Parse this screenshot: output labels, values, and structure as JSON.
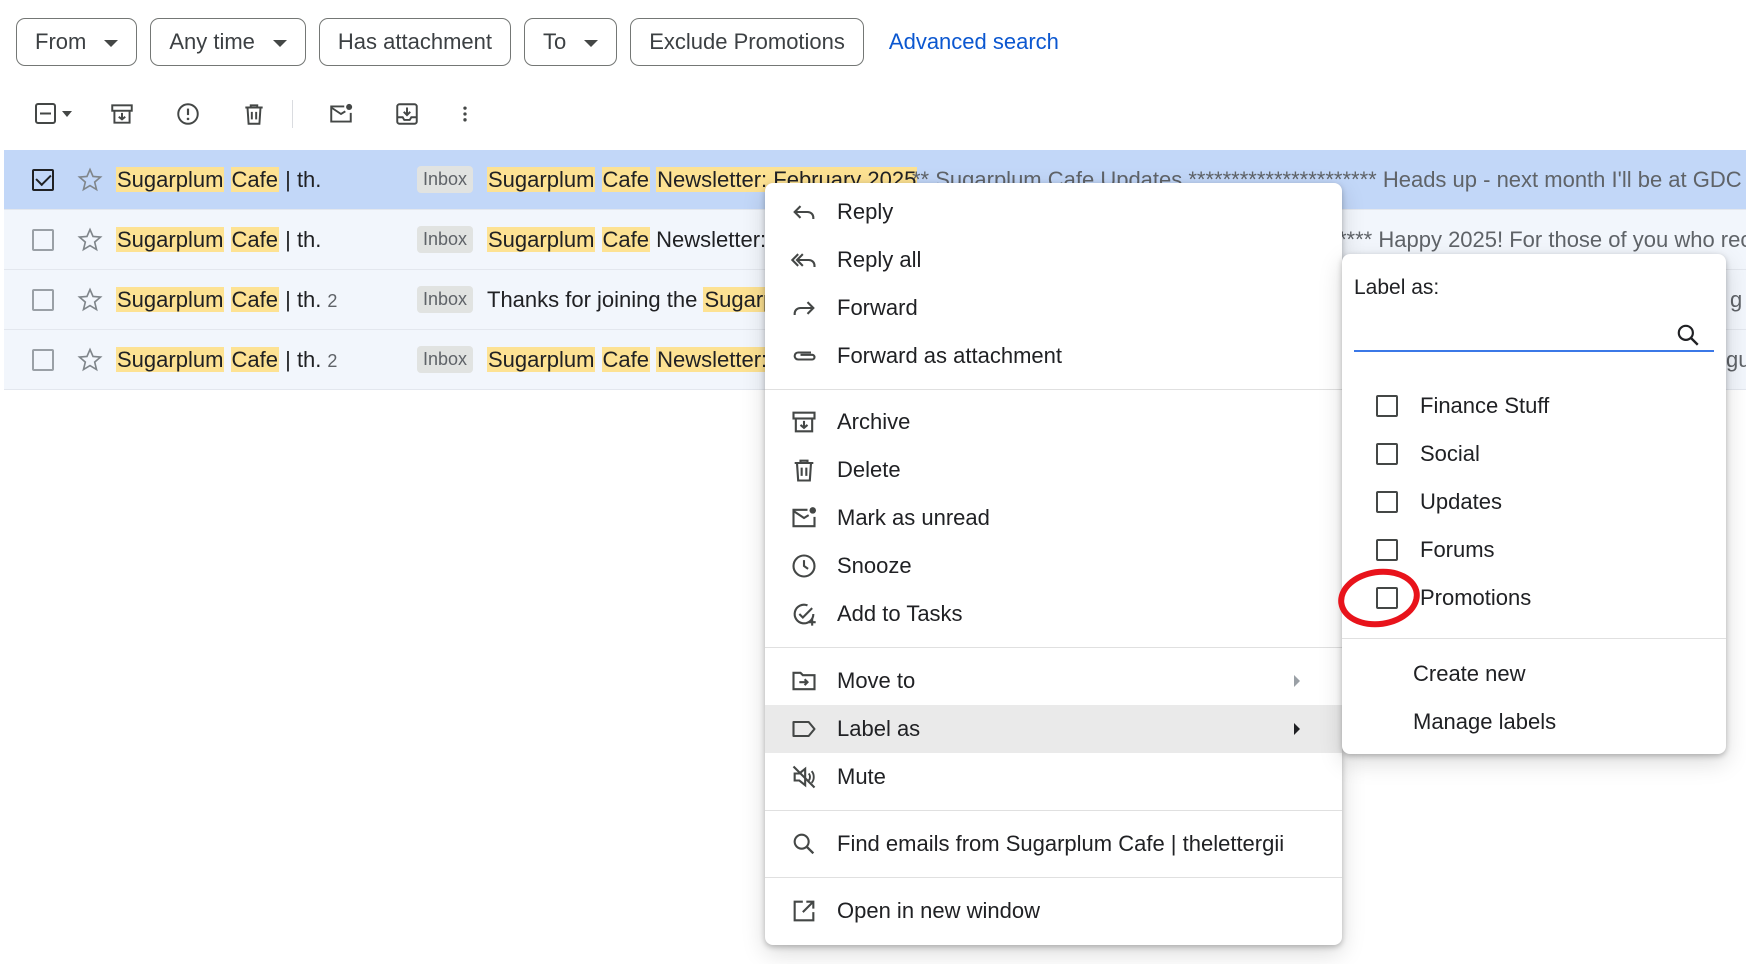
{
  "filters": {
    "chips": [
      {
        "label": "From",
        "dropdown": true
      },
      {
        "label": "Any time",
        "dropdown": true
      },
      {
        "label": "Has attachment",
        "dropdown": false
      },
      {
        "label": "To",
        "dropdown": true
      },
      {
        "label": "Exclude Promotions",
        "dropdown": false
      }
    ],
    "advanced_search": "Advanced search"
  },
  "toolbar": {
    "icons": [
      "select-all-checkbox-icon",
      "dropdown-caret-icon",
      "archive-icon",
      "report-spam-icon",
      "delete-icon",
      "mark-unread-icon",
      "move-to-inbox-icon",
      "more-vert-icon"
    ]
  },
  "emails": [
    {
      "selected": true,
      "sender_hl1": "Sugarplum",
      "sender_hl2": "Cafe",
      "sender_rest": " | th.",
      "count": "",
      "badge": "Inbox",
      "subject": "Newsletter: February 2025",
      "snippet": "** Sugarplum Cafe Updates ********************** Heads up - next month I'll be at GDC"
    },
    {
      "selected": false,
      "sender_hl1": "Sugarplum",
      "sender_hl2": "Cafe",
      "sender_rest": " | th.",
      "count": "",
      "badge": "Inbox",
      "subject": "Newsletter: J",
      "snippet": "**** Happy 2025! For those of you who rec"
    },
    {
      "selected": false,
      "sender_hl1": "Sugarplum",
      "sender_hl2": "Cafe",
      "sender_rest": " | th.",
      "count": "2",
      "badge": "Inbox",
      "subject": "Thanks for joining the ",
      "subject_hl": "Sugarpl",
      "snippet": "g"
    },
    {
      "selected": false,
      "sender_hl1": "Sugarplum",
      "sender_hl2": "Cafe",
      "sender_rest": " | th.",
      "count": "2",
      "badge": "Inbox",
      "subject": "Newsletter: D",
      "snippet": "gu"
    }
  ],
  "context_menu": {
    "reply": "Reply",
    "reply_all": "Reply all",
    "forward": "Forward",
    "forward_attachment": "Forward as attachment",
    "archive": "Archive",
    "delete": "Delete",
    "mark_unread": "Mark as unread",
    "snooze": "Snooze",
    "add_tasks": "Add to Tasks",
    "move_to": "Move to",
    "label_as": "Label as",
    "mute": "Mute",
    "find_emails": "Find emails from Sugarplum Cafe | thelettergii",
    "open_new_window": "Open in new window"
  },
  "label_menu": {
    "title": "Label as:",
    "search_value": "",
    "options": [
      "Finance Stuff",
      "Social",
      "Updates",
      "Forums",
      "Promotions"
    ],
    "create_new": "Create new",
    "manage_labels": "Manage labels"
  },
  "colors": {
    "accent": "#0b57d0",
    "highlight": "#fde293",
    "selected_row": "#c2d7f8",
    "annotation": "#e8131b"
  }
}
